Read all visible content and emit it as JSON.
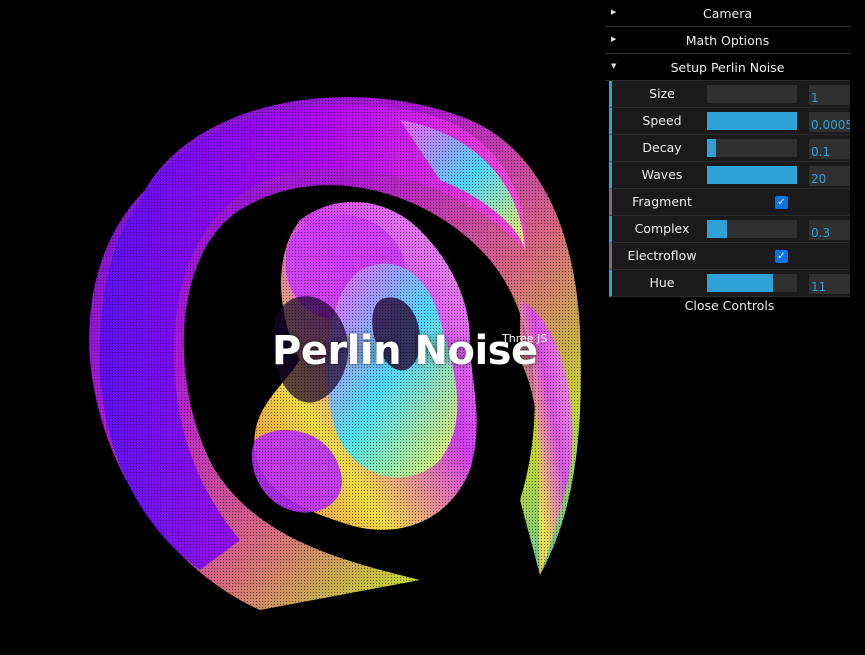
{
  "title": "Perlin Noise",
  "subtitle": "Three JS",
  "panel": {
    "folders": [
      {
        "label": "Camera",
        "open": false
      },
      {
        "label": "Math Options",
        "open": false
      },
      {
        "label": "Setup Perlin Noise",
        "open": true
      }
    ],
    "controls": [
      {
        "label": "Size",
        "type": "slider",
        "value": "1",
        "fill": 0.0
      },
      {
        "label": "Speed",
        "type": "slider",
        "value": "0.0005",
        "fill": 1.0
      },
      {
        "label": "Decay",
        "type": "slider",
        "value": "0.1",
        "fill": 0.1
      },
      {
        "label": "Waves",
        "type": "slider",
        "value": "20",
        "fill": 1.0
      },
      {
        "label": "Fragment",
        "type": "checkbox",
        "checked": true
      },
      {
        "label": "Complex",
        "type": "slider",
        "value": "0.3",
        "fill": 0.22
      },
      {
        "label": "Electroflow",
        "type": "checkbox",
        "checked": true
      },
      {
        "label": "Hue",
        "type": "slider",
        "value": "11",
        "fill": 0.73
      }
    ],
    "close_label": "Close Controls"
  },
  "colors": {
    "accent": "#2fa1d6",
    "bool_accent": "#806787",
    "checkbox": "#0a74e6",
    "background": "#000000"
  }
}
